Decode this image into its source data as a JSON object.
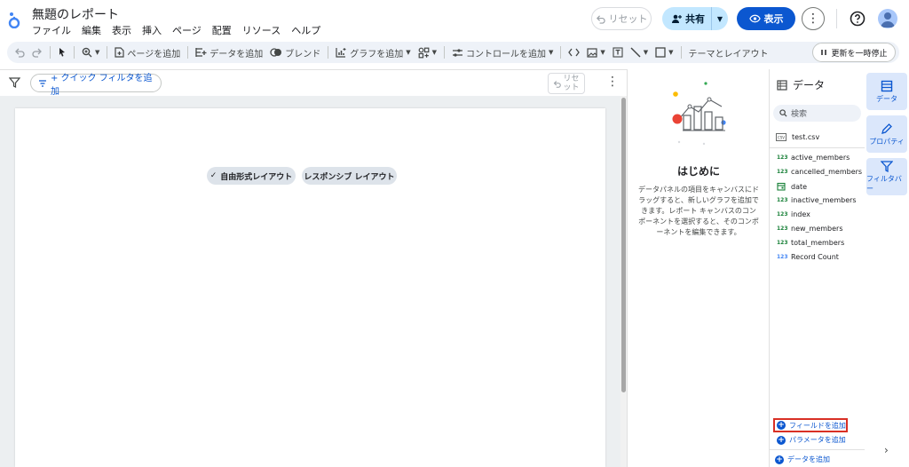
{
  "app": {
    "title": "無題のレポート",
    "menu": [
      "ファイル",
      "編集",
      "表示",
      "挿入",
      "ページ",
      "配置",
      "リソース",
      "ヘルプ"
    ]
  },
  "header": {
    "reset_label": "リセット",
    "share_label": "共有",
    "view_label": "表示"
  },
  "toolbar": {
    "add_page": "ページを追加",
    "add_data": "データを追加",
    "blend": "ブレンド",
    "add_chart": "グラフを追加",
    "add_control": "コントロールを追加",
    "theme_layout": "テーマとレイアウト",
    "pause_update": "更新を一時停止"
  },
  "filterbar": {
    "quick_filter": "+ クイック フィルタを追加",
    "reset_line1": "リセ",
    "reset_line2": "ット"
  },
  "canvas": {
    "chip_freeform": "自由形式レイアウト",
    "chip_responsive": "レスポンシブ レイアウト"
  },
  "intro": {
    "title": "はじめに",
    "body": "データパネルの項目をキャンバスにドラッグすると、新しいグラフを追加できます。レポート キャンバスのコンポーネントを選択すると、そのコンポーネントを編集できます。"
  },
  "datapanel": {
    "title": "データ",
    "search_placeholder": "検索",
    "source": "test.csv",
    "fields": [
      {
        "type": "123",
        "name": "active_members"
      },
      {
        "type": "123",
        "name": "cancelled_members"
      },
      {
        "type": "date",
        "name": "date"
      },
      {
        "type": "123",
        "name": "inactive_members"
      },
      {
        "type": "123",
        "name": "index"
      },
      {
        "type": "123",
        "name": "new_members"
      },
      {
        "type": "123",
        "name": "total_members"
      },
      {
        "type": "123",
        "name": "Record Count"
      }
    ],
    "add_field": "フィールドを追加",
    "add_parameter": "パラメータを追加",
    "add_data": "データを追加"
  },
  "rail": {
    "data": "データ",
    "properties": "プロパティ",
    "filter_bar": "フィルタバー"
  },
  "colors": {
    "primary": "#0b57d0",
    "share_bg": "#c2e7ff",
    "highlight": "#d93025",
    "numeric_field": "#188038"
  }
}
